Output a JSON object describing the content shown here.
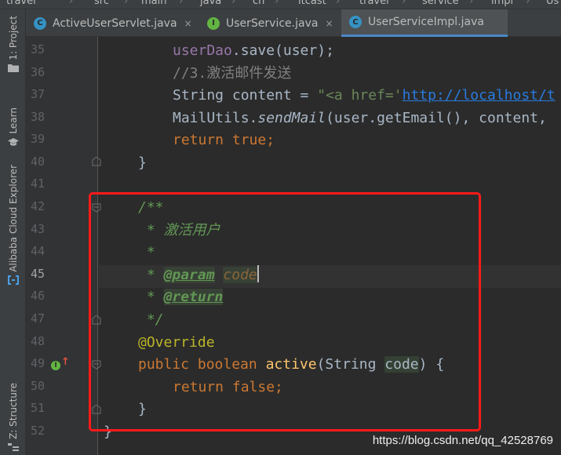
{
  "breadcrumb": [
    "travel",
    "src",
    "main",
    "java",
    "cn",
    "itcast",
    "travel",
    "service",
    "impl",
    "Us"
  ],
  "tool_windows": {
    "project": "1: Project",
    "learn": "Learn",
    "alibaba": "Alibaba Cloud Explorer",
    "structure": "Z: Structure"
  },
  "tabs": [
    {
      "label": "ActiveUserServlet.java",
      "icon": "class-icon",
      "close": "×"
    },
    {
      "label": "UserService.java",
      "icon": "interface-icon",
      "close": "×"
    },
    {
      "label": "UserServiceImpl.java",
      "icon": "class-icon",
      "active": true
    }
  ],
  "colors": {
    "accent": "#4a88c7",
    "highlight_box": "#ff1a1a",
    "keyword": "#cc7832",
    "string": "#6a8759",
    "javadoc": "#629755"
  },
  "line_numbers": [
    "35",
    "36",
    "37",
    "38",
    "39",
    "40",
    "41",
    "42",
    "43",
    "44",
    "45",
    "46",
    "47",
    "48",
    "49",
    "50",
    "51",
    "52"
  ],
  "current_line": "45",
  "code": {
    "l35_a": "userDao",
    "l35_b": ".save(user);",
    "l36": "//3.激活邮件发送",
    "l37_a": "String content = ",
    "l37_b": "\"<a href='",
    "l37_c": "http://localhost/t",
    "l38_a": "MailUtils.",
    "l38_b": "sendMail",
    "l38_c": "(user.getEmail(), content,",
    "l39_a": "return ",
    "l39_b": "true",
    "l39_c": ";",
    "l40": "}",
    "l42": "/**",
    "l43": " * 激活用户",
    "l44": " *",
    "l45_a": " * ",
    "l45_b": "@param",
    "l45_c": "code",
    "l46_a": " * ",
    "l46_b": "@return",
    "l47": " */",
    "l48": "@Override",
    "l49_a": "public boolean ",
    "l49_b": "active",
    "l49_c": "(String ",
    "l49_d": "code",
    "l49_e": ") {",
    "l50_a": "return false",
    "l50_b": ";",
    "l51": "}",
    "l52": "}"
  },
  "gutter_marker": "I",
  "watermark": "https://blog.csdn.net/qq_42528769"
}
